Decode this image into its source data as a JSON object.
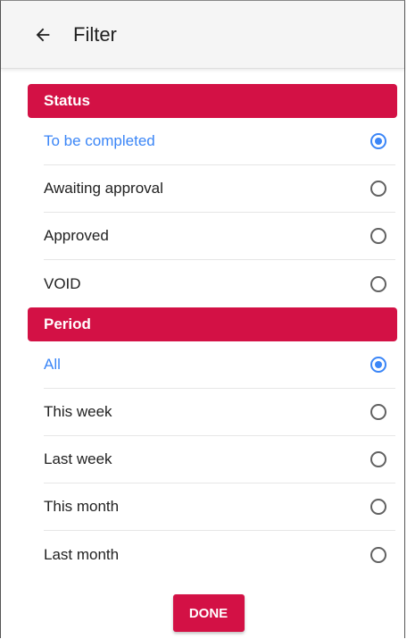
{
  "header": {
    "title": "Filter",
    "back_icon": "arrow-left-icon"
  },
  "status": {
    "title": "Status",
    "options": [
      {
        "label": "To be completed",
        "selected": true
      },
      {
        "label": "Awaiting approval",
        "selected": false
      },
      {
        "label": "Approved",
        "selected": false
      },
      {
        "label": "VOID",
        "selected": false
      }
    ]
  },
  "period": {
    "title": "Period",
    "options": [
      {
        "label": "All",
        "selected": true
      },
      {
        "label": "This week",
        "selected": false
      },
      {
        "label": "Last week",
        "selected": false
      },
      {
        "label": "This month",
        "selected": false
      },
      {
        "label": "Last month",
        "selected": false
      }
    ]
  },
  "actions": {
    "done_label": "DONE"
  },
  "colors": {
    "accent": "#d31145",
    "selected": "#3b86f7"
  }
}
